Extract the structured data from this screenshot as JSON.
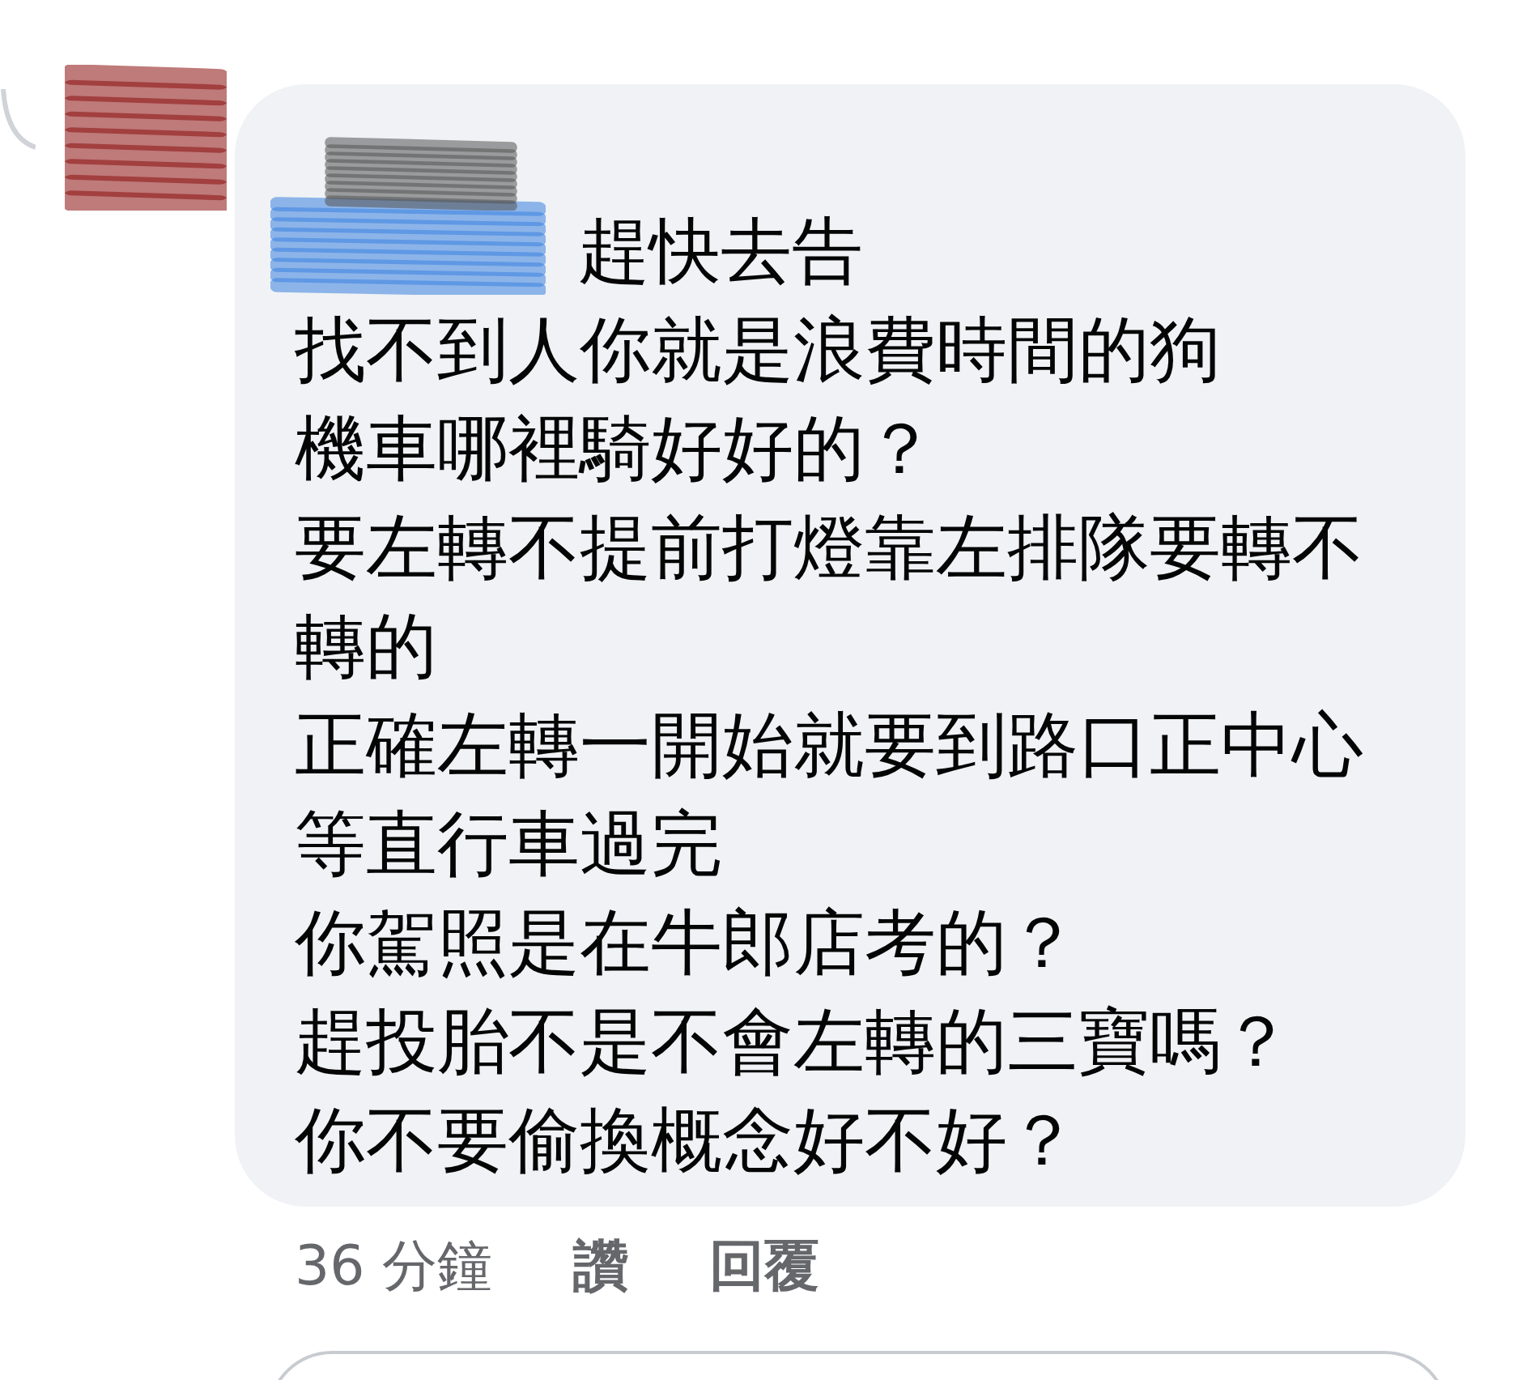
{
  "comment": {
    "lines": [
      "趕快去告",
      "找不到人你就是浪費時間的狗",
      "機車哪裡騎好好的？",
      "要左轉不提前打燈靠左排隊要轉不轉的",
      "正確左轉一開始就要到路口正中心等直行車過完",
      "你駕照是在牛郎店考的？",
      "趕投胎不是不會左轉的三寶嗎？",
      "你不要偷換概念好不好？"
    ],
    "time": "36 分鐘",
    "actions": [
      {
        "label": "讚"
      },
      {
        "label": "回覆"
      }
    ]
  }
}
